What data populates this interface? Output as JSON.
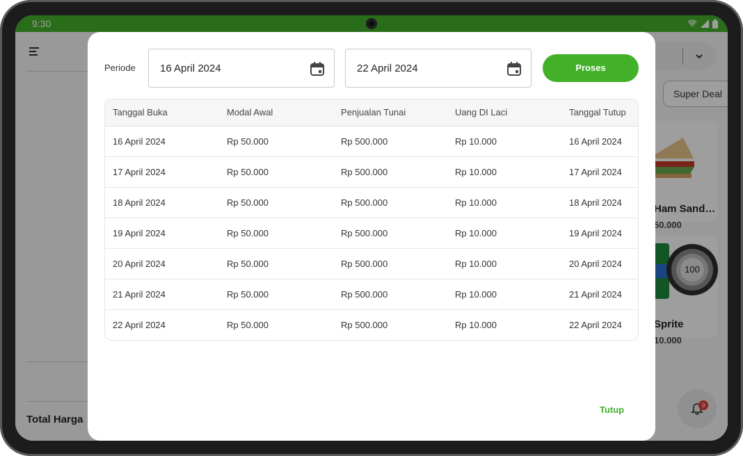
{
  "status_bar": {
    "time": "9:30"
  },
  "background": {
    "total_label": "Total Harga",
    "chip_label": "Super Deal",
    "products": [
      {
        "name": "Ham Sand…",
        "price": "50.000"
      },
      {
        "name": "Sprite",
        "price": "10.000"
      }
    ],
    "stock_badge": "100",
    "notification_count": "9"
  },
  "modal": {
    "periode_label": "Periode",
    "start_date": "16 April 2024",
    "end_date": "22 April 2024",
    "proses_label": "Proses",
    "tutup_label": "Tutup",
    "table": {
      "headers": [
        "Tanggal Buka",
        "Modal Awal",
        "Penjualan Tunai",
        "Uang DI Laci",
        "Tanggal Tutup"
      ],
      "rows": [
        [
          "16 April 2024",
          "Rp 50.000",
          "Rp 500.000",
          "Rp 10.000",
          "16 April 2024"
        ],
        [
          "17 April 2024",
          "Rp 50.000",
          "Rp 500.000",
          "Rp 10.000",
          "17 April 2024"
        ],
        [
          "18 April 2024",
          "Rp 50.000",
          "Rp 500.000",
          "Rp 10.000",
          "18 April 2024"
        ],
        [
          "19 April 2024",
          "Rp 50.000",
          "Rp 500.000",
          "Rp 10.000",
          "19 April 2024"
        ],
        [
          "20 April 2024",
          "Rp 50.000",
          "Rp 500.000",
          "Rp 10.000",
          "20 April 2024"
        ],
        [
          "21 April 2024",
          "Rp 50.000",
          "Rp 500.000",
          "Rp 10.000",
          "21 April 2024"
        ],
        [
          "22 April 2024",
          "Rp 50.000",
          "Rp 500.000",
          "Rp 10.000",
          "22 April 2024"
        ]
      ]
    }
  },
  "colors": {
    "accent": "#43b02a",
    "badge_red": "#e53935"
  },
  "icons": [
    "calendar-icon",
    "menu-icon",
    "chevron-down-icon",
    "bell-icon",
    "wifi-icon",
    "signal-icon",
    "battery-icon"
  ]
}
